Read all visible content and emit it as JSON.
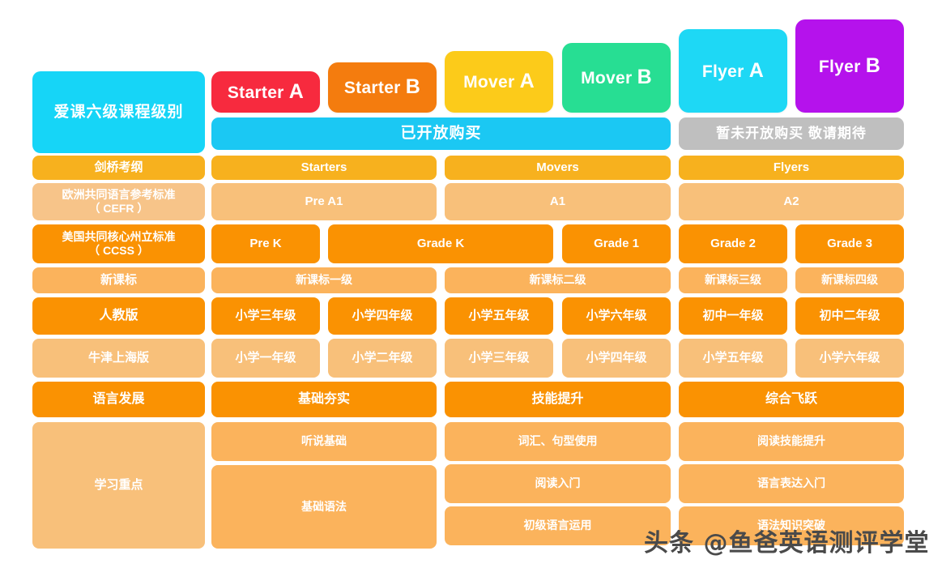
{
  "title_cell": {
    "label": "爱课六级课程级别"
  },
  "levels": [
    {
      "name": "Starter",
      "suffix": "A",
      "color": "#F72A3E"
    },
    {
      "name": "Starter",
      "suffix": "B",
      "color": "#F47C0E"
    },
    {
      "name": "Mover",
      "suffix": "A",
      "color": "#FCCB1A"
    },
    {
      "name": "Mover",
      "suffix": "B",
      "color": "#27DE93"
    },
    {
      "name": "Flyer",
      "suffix": "A",
      "color": "#1ED8F5"
    },
    {
      "name": "Flyer",
      "suffix": "B",
      "color": "#B512EC"
    }
  ],
  "availability": {
    "open_label": "已开放购买",
    "closed_label": "暂未开放购买  敬请期待",
    "open_color": "#1BC8F3",
    "closed_color": "#BFBFBF"
  },
  "rows": {
    "cambridge": {
      "label": "剑桥考纲",
      "values": [
        "Starters",
        "Movers",
        "Flyers"
      ]
    },
    "cefr": {
      "label": "欧洲共同语言参考标准\n（ CEFR ）",
      "values": [
        "Pre A1",
        "A1",
        "A2"
      ]
    },
    "ccss": {
      "label": "美国共同核心州立标准\n（ CCSS ）",
      "values": [
        "Pre K",
        "Grade K",
        "Grade 1",
        "Grade 2",
        "Grade 3"
      ]
    },
    "xinkebiao": {
      "label": "新课标",
      "values": [
        "新课标一级",
        "新课标二级",
        "新课标三级",
        "新课标四级"
      ]
    },
    "renjiao": {
      "label": "人教版",
      "values": [
        "小学三年级",
        "小学四年级",
        "小学五年级",
        "小学六年级",
        "初中一年级",
        "初中二年级"
      ]
    },
    "oxford": {
      "label": "牛津上海版",
      "values": [
        "小学一年级",
        "小学二年级",
        "小学三年级",
        "小学四年级",
        "小学五年级",
        "小学六年级"
      ]
    },
    "language": {
      "label": "语言发展",
      "values": [
        "基础夯实",
        "技能提升",
        "综合飞跃"
      ]
    },
    "focus": {
      "label": "学习重点",
      "groups": [
        {
          "items": [
            "听说基础",
            "基础语法"
          ]
        },
        {
          "items": [
            "词汇、句型使用",
            "阅读入门",
            "初级语言运用"
          ]
        },
        {
          "items": [
            "阅读技能提升",
            "语言表达入门",
            "语法知识突破"
          ]
        }
      ]
    }
  },
  "watermark": {
    "text": "头条 @鱼爸英语测评学堂"
  }
}
